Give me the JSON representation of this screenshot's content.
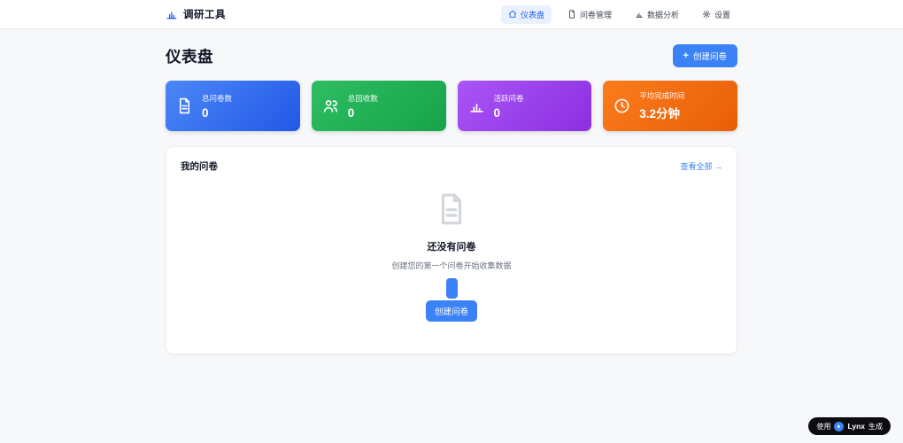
{
  "app": {
    "name": "调研工具"
  },
  "nav": {
    "items": [
      {
        "label": "仪表盘",
        "icon": "home-icon",
        "active": true
      },
      {
        "label": "问卷管理",
        "icon": "document-icon",
        "active": false
      },
      {
        "label": "数据分析",
        "icon": "bar-chart-icon",
        "active": false
      },
      {
        "label": "设置",
        "icon": "gear-icon",
        "active": false
      }
    ]
  },
  "page": {
    "title": "仪表盘",
    "create_button": {
      "plus": "+",
      "label": "创建问卷"
    }
  },
  "stats": {
    "cards": [
      {
        "label": "总问卷数",
        "value": "0",
        "icon": "document-icon",
        "gradient_from": "#4b87f6",
        "gradient_to": "#2258e8"
      },
      {
        "label": "总回收数",
        "value": "0",
        "icon": "people-icon",
        "gradient_from": "#2ebd62",
        "gradient_to": "#17a34a"
      },
      {
        "label": "活跃问卷",
        "value": "0",
        "icon": "bar-chart-icon",
        "gradient_from": "#a955f7",
        "gradient_to": "#8c2fe0"
      },
      {
        "label": "平均完成时间",
        "value": "3.2分钟",
        "icon": "clock-icon",
        "gradient_from": "#fb7c1c",
        "gradient_to": "#e85e07"
      }
    ]
  },
  "panel": {
    "title": "我的问卷",
    "view_all": "查看全部 →",
    "empty_state": {
      "title": "还没有问卷",
      "subtitle": "创建您的第一个问卷开始收集数据",
      "button": "创建问卷"
    }
  },
  "badge": {
    "prefix": "使用",
    "brand": "Lynx",
    "suffix": "生成"
  },
  "colors": {
    "primary": "#3b82f6",
    "nav_active": "#2563eb",
    "background": "#f7f8fa",
    "empty_icon_gray": "#d3d6dc",
    "badge_bg": "#0c0d10"
  }
}
